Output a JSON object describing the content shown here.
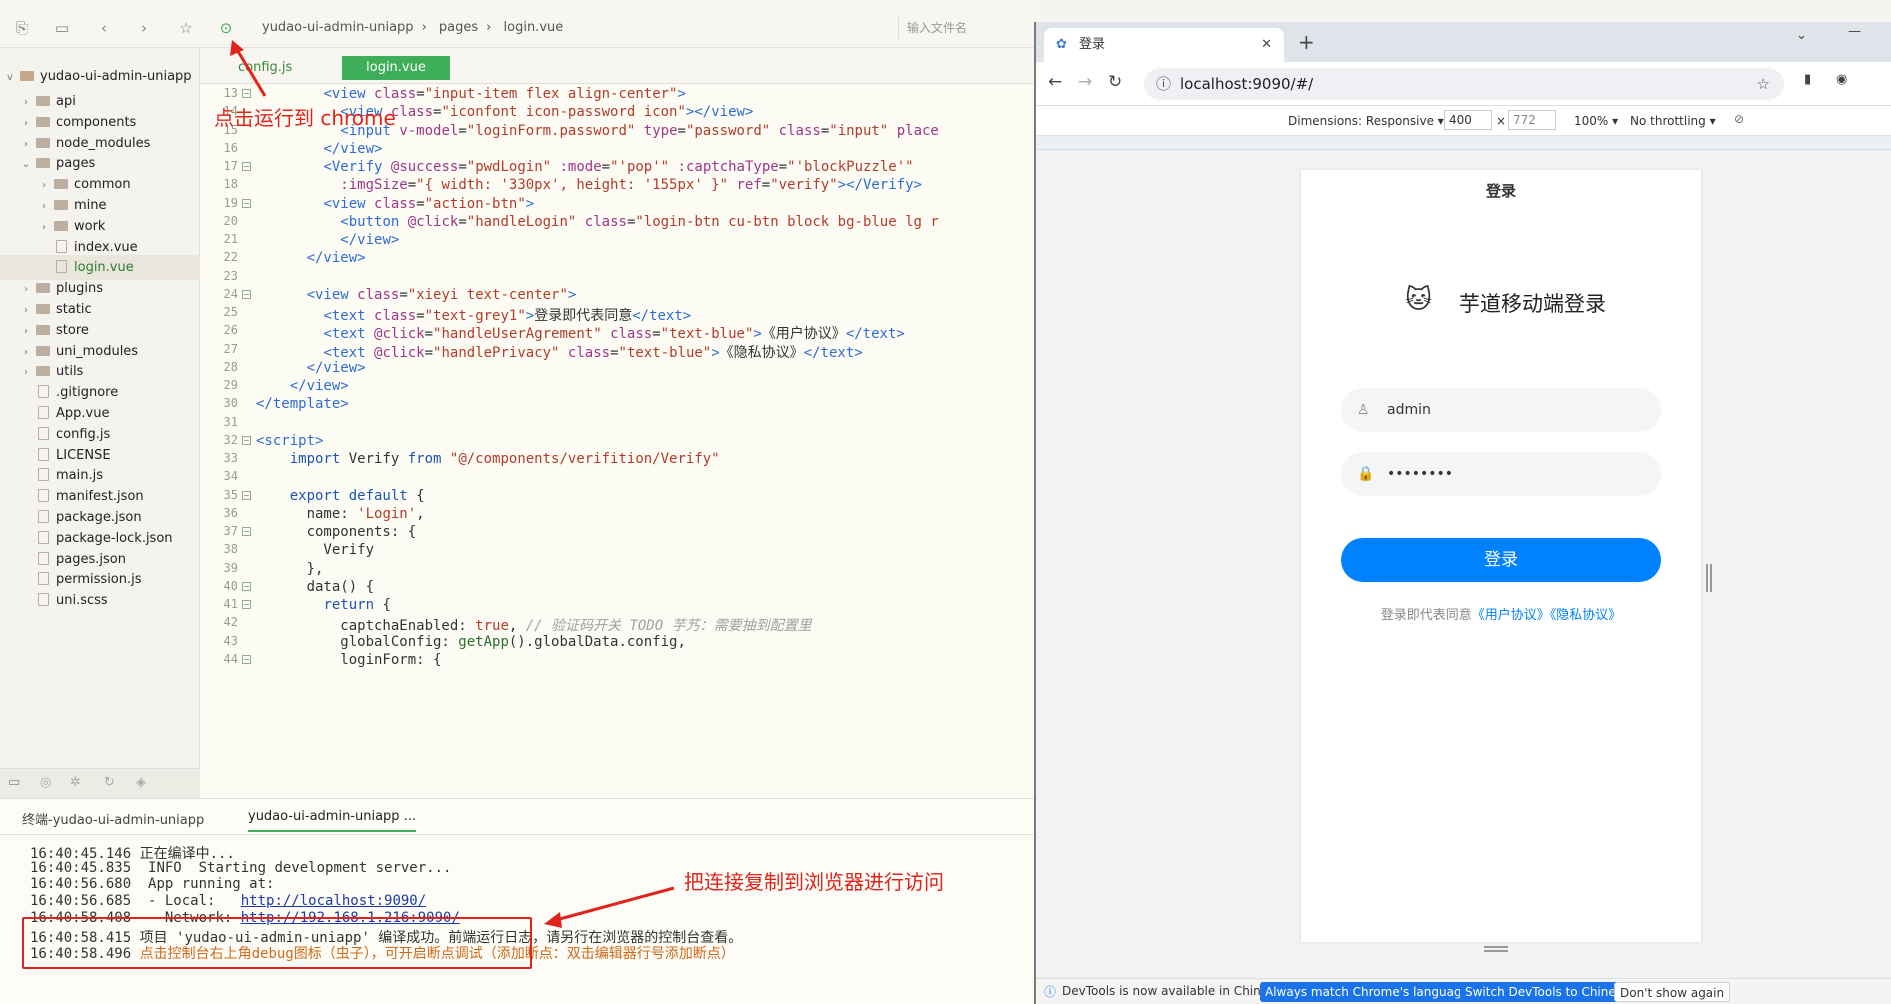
{
  "toolbar": {
    "crumbs": [
      "yudao-ui-admin-uniapp",
      "pages",
      "login.vue"
    ],
    "search_placeholder": "输入文件名"
  },
  "tabs": {
    "items": [
      "config.js",
      "login.vue"
    ],
    "active": "login.vue"
  },
  "sidebar": {
    "project": "yudao-ui-admin-uniapp",
    "items": [
      {
        "label": "api",
        "kind": "folder",
        "depth": 1,
        "chev": ">"
      },
      {
        "label": "components",
        "kind": "folder",
        "depth": 1,
        "chev": ">"
      },
      {
        "label": "node_modules",
        "kind": "folder",
        "depth": 1,
        "chev": ">"
      },
      {
        "label": "pages",
        "kind": "folder",
        "depth": 1,
        "chev": "v"
      },
      {
        "label": "common",
        "kind": "folder",
        "depth": 2,
        "chev": ">"
      },
      {
        "label": "mine",
        "kind": "folder",
        "depth": 2,
        "chev": ">"
      },
      {
        "label": "work",
        "kind": "folder",
        "depth": 2,
        "chev": ">"
      },
      {
        "label": "index.vue",
        "kind": "file",
        "depth": 2,
        "chev": ""
      },
      {
        "label": "login.vue",
        "kind": "file",
        "depth": 2,
        "chev": "",
        "selected": true
      },
      {
        "label": "plugins",
        "kind": "folder",
        "depth": 1,
        "chev": ">"
      },
      {
        "label": "static",
        "kind": "folder",
        "depth": 1,
        "chev": ">"
      },
      {
        "label": "store",
        "kind": "folder",
        "depth": 1,
        "chev": ">"
      },
      {
        "label": "uni_modules",
        "kind": "folder",
        "depth": 1,
        "chev": ">"
      },
      {
        "label": "utils",
        "kind": "folder",
        "depth": 1,
        "chev": ">"
      },
      {
        "label": ".gitignore",
        "kind": "file",
        "depth": 1,
        "chev": ""
      },
      {
        "label": "App.vue",
        "kind": "file",
        "depth": 1,
        "chev": ""
      },
      {
        "label": "config.js",
        "kind": "file",
        "depth": 1,
        "chev": ""
      },
      {
        "label": "LICENSE",
        "kind": "file",
        "depth": 1,
        "chev": ""
      },
      {
        "label": "main.js",
        "kind": "file",
        "depth": 1,
        "chev": ""
      },
      {
        "label": "manifest.json",
        "kind": "file",
        "depth": 1,
        "chev": ""
      },
      {
        "label": "package.json",
        "kind": "file",
        "depth": 1,
        "chev": ""
      },
      {
        "label": "package-lock.json",
        "kind": "file",
        "depth": 1,
        "chev": ""
      },
      {
        "label": "pages.json",
        "kind": "file",
        "depth": 1,
        "chev": ""
      },
      {
        "label": "permission.js",
        "kind": "file",
        "depth": 1,
        "chev": ""
      },
      {
        "label": "uni.scss",
        "kind": "file",
        "depth": 1,
        "chev": ""
      }
    ]
  },
  "editor": {
    "lines": [
      {
        "n": "13",
        "fold": true,
        "html": "        <span class='tg'>&lt;view</span> <span class='at'>class</span>=<span class='st'>\"input-item flex align-center\"</span><span class='tg'>&gt;</span>"
      },
      {
        "n": "14",
        "fold": false,
        "html": "          <span class='tg'>&lt;view</span> <span class='at'>class</span>=<span class='st'>\"iconfont icon-password icon\"</span><span class='tg'>&gt;&lt;/view&gt;</span>"
      },
      {
        "n": "15",
        "fold": false,
        "html": "          <span class='tg'>&lt;input</span> <span class='at'>v-model</span>=<span class='st'>\"loginForm.password\"</span> <span class='at'>type</span>=<span class='st'>\"password\"</span> <span class='at'>class</span>=<span class='st'>\"input\"</span> <span class='at'>place</span>"
      },
      {
        "n": "16",
        "fold": false,
        "html": "        <span class='tg'>&lt;/view&gt;</span>"
      },
      {
        "n": "17",
        "fold": true,
        "html": "        <span class='tg'>&lt;Verify</span> <span class='at'>@success</span>=<span class='st'>\"pwdLogin\"</span> <span class='at'>:mode</span>=<span class='st'>\"'pop'\"</span> <span class='at'>:captchaType</span>=<span class='st'>\"'blockPuzzle'\"</span>"
      },
      {
        "n": "18",
        "fold": false,
        "html": "          <span class='at'>:imgSize</span>=<span class='st'>\"{ width: '330px', height: '155px' }\"</span> <span class='at'>ref</span>=<span class='st'>\"verify\"</span><span class='tg'>&gt;&lt;/Verify&gt;</span>"
      },
      {
        "n": "19",
        "fold": true,
        "html": "        <span class='tg'>&lt;view</span> <span class='at'>class</span>=<span class='st'>\"action-btn\"</span><span class='tg'>&gt;</span>"
      },
      {
        "n": "20",
        "fold": false,
        "html": "          <span class='tg'>&lt;button</span> <span class='at'>@click</span>=<span class='st'>\"handleLogin\"</span> <span class='at'>class</span>=<span class='st'>\"login-btn cu-btn block bg-blue lg r</span>"
      },
      {
        "n": "21",
        "fold": false,
        "html": "          <span class='tg'>&lt;/view&gt;</span>"
      },
      {
        "n": "22",
        "fold": false,
        "html": "      <span class='tg'>&lt;/view&gt;</span>"
      },
      {
        "n": "23",
        "fold": false,
        "html": ""
      },
      {
        "n": "24",
        "fold": true,
        "html": "      <span class='tg'>&lt;view</span> <span class='at'>class</span>=<span class='st'>\"xieyi text-center\"</span><span class='tg'>&gt;</span>"
      },
      {
        "n": "25",
        "fold": false,
        "html": "        <span class='tg'>&lt;text</span> <span class='at'>class</span>=<span class='st'>\"text-grey1\"</span><span class='tg'>&gt;</span>登录即代表同意<span class='tg'>&lt;/text&gt;</span>"
      },
      {
        "n": "26",
        "fold": false,
        "html": "        <span class='tg'>&lt;text</span> <span class='at'>@click</span>=<span class='st'>\"handleUserAgrement\"</span> <span class='at'>class</span>=<span class='st'>\"text-blue\"</span><span class='tg'>&gt;</span>《用户协议》<span class='tg'>&lt;/text&gt;</span>"
      },
      {
        "n": "27",
        "fold": false,
        "html": "        <span class='tg'>&lt;text</span> <span class='at'>@click</span>=<span class='st'>\"handlePrivacy\"</span> <span class='at'>class</span>=<span class='st'>\"text-blue\"</span><span class='tg'>&gt;</span>《隐私协议》<span class='tg'>&lt;/text&gt;</span>"
      },
      {
        "n": "28",
        "fold": false,
        "html": "      <span class='tg'>&lt;/view&gt;</span>"
      },
      {
        "n": "29",
        "fold": false,
        "html": "    <span class='tg'>&lt;/view&gt;</span>"
      },
      {
        "n": "30",
        "fold": false,
        "html": "<span class='tg'>&lt;/template&gt;</span>"
      },
      {
        "n": "31",
        "fold": false,
        "html": ""
      },
      {
        "n": "32",
        "fold": true,
        "html": "<span class='tg'>&lt;script&gt;</span>"
      },
      {
        "n": "33",
        "fold": false,
        "html": "    <span class='kw'>import</span> Verify <span class='kw'>from</span> <span class='st'>\"@/components/verifition/Verify\"</span>"
      },
      {
        "n": "34",
        "fold": false,
        "html": ""
      },
      {
        "n": "35",
        "fold": true,
        "html": "    <span class='kw'>export default</span> {"
      },
      {
        "n": "36",
        "fold": false,
        "html": "      name: <span class='st'>'Login'</span>,"
      },
      {
        "n": "37",
        "fold": true,
        "html": "      components: {"
      },
      {
        "n": "38",
        "fold": false,
        "html": "        Verify"
      },
      {
        "n": "39",
        "fold": false,
        "html": "      },"
      },
      {
        "n": "40",
        "fold": true,
        "html": "      data() {"
      },
      {
        "n": "41",
        "fold": true,
        "html": "        <span class='kw'>return</span> {"
      },
      {
        "n": "42",
        "fold": false,
        "html": "          captchaEnabled: <span class='bool'>true</span>, <span class='cm'>// 验证码开关 TODO 芋艿：需要抽到配置里</span>"
      },
      {
        "n": "43",
        "fold": false,
        "html": "          globalConfig: <span class='fn'>getApp</span>().globalData.config,"
      },
      {
        "n": "44",
        "fold": true,
        "html": "          loginForm: {"
      }
    ]
  },
  "console": {
    "tabs": [
      "终端-yudao-ui-admin-uniapp",
      "yudao-ui-admin-uniapp ..."
    ],
    "lines": [
      {
        "time": "16:40:45.146",
        "text": " 正在编译中..."
      },
      {
        "time": "16:40:45.835",
        "text": "  INFO  Starting development server..."
      },
      {
        "time": "16:40:56.680",
        "text": "  App running at:"
      },
      {
        "time": "16:40:56.685",
        "text": "  - Local:   ",
        "link": "http://localhost:9090/"
      },
      {
        "time": "16:40:58.408",
        "text": "  - Network: ",
        "link": "http://192.168.1.216:9090/"
      },
      {
        "time": "16:40:58.415",
        "text": " 项目 'yudao-ui-admin-uniapp' 编译成功。前端运行日志，请另行在浏览器的控制台查看。"
      },
      {
        "time": "16:40:58.496",
        "text": " 点击控制台右上角debug图标（虫子），可开启断点调试（添加断点：双击编辑器行号添加断点）",
        "warn": true
      }
    ]
  },
  "annotations": {
    "run": "点击运行到 chrome",
    "copy": "把连接复制到浏览器进行访问"
  },
  "browser": {
    "tab_title": "登录",
    "url": "localhost:9090/#/",
    "dimensions": "Dimensions: Responsive",
    "width": "400",
    "height": "772",
    "zoom": "100%",
    "throttle": "No throttling"
  },
  "app": {
    "nav_title": "登录",
    "heading": "芋道移动端登录",
    "username": "admin",
    "password": "••••••••",
    "login_btn": "登录",
    "agree_prefix": "登录即代表同意",
    "user_agreement": "《用户协议》",
    "privacy": "《隐私协议》"
  },
  "notice": {
    "text": "DevTools is now available in Chinese!",
    "btn1": "Always match Chrome's language",
    "btn2": "Switch DevTools to Chinese",
    "btn3": "Don't show again"
  },
  "colors": {
    "accent": "#0081ff",
    "annotation": "#e0241b",
    "tab_active": "#3fae5a"
  }
}
